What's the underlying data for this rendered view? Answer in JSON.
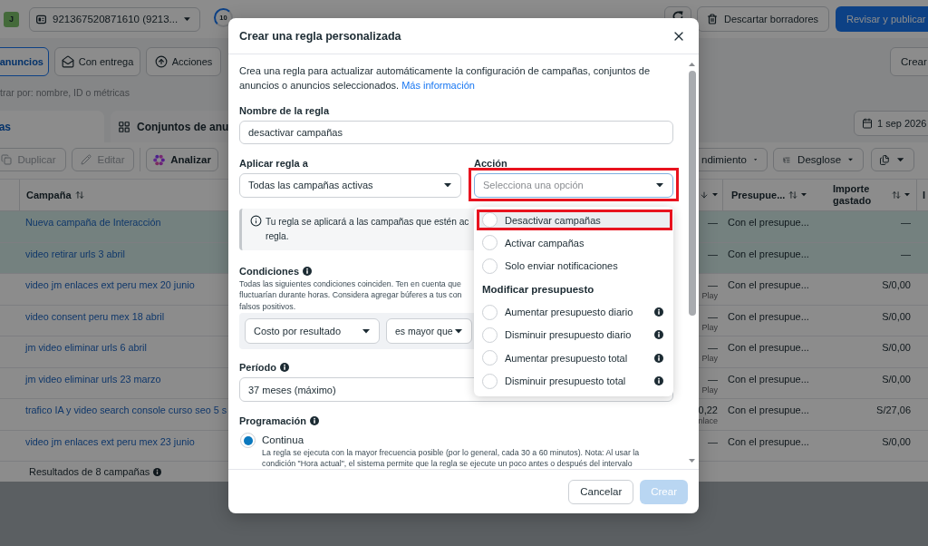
{
  "topbar": {
    "avatar": "J",
    "account": "921367520871610 (9213...",
    "progress": "10",
    "discard_button": "Descartar borradores",
    "publish_button": "Revisar y publicar"
  },
  "filter_bar": {
    "buttons": [
      {
        "label": "anuncios",
        "selected": true
      },
      {
        "label": "Con entrega",
        "selected": false
      },
      {
        "label": "Acciones",
        "selected": false
      }
    ],
    "create_button": "Crear",
    "search": {
      "placeholder": "trar por: nombre, ID o métricas"
    }
  },
  "tabs": [
    {
      "label": "as",
      "selected": true
    },
    {
      "label": "Conjuntos de anu",
      "selected": false
    }
  ],
  "date_range": "1 sep 2026",
  "toolbar": {
    "actions": [
      {
        "label": "Duplicar",
        "disabled": true
      },
      {
        "label": "Editar",
        "disabled": true
      },
      {
        "label": "Analizar",
        "disabled": false
      }
    ],
    "menus": [
      {
        "label": "ndimiento"
      },
      {
        "label": "Desglose"
      }
    ]
  },
  "table": {
    "columns": [
      {
        "label": "Campaña"
      },
      {
        "label": "Presupue..."
      },
      {
        "label": "Importe gastado"
      },
      {
        "label": "I"
      }
    ],
    "rows": [
      {
        "name": "Nueva campaña de Interacción",
        "selected": true,
        "column_2": "—",
        "budget": "Con el presupue...",
        "spent": "—"
      },
      {
        "name": "video retirar urls 3 abril",
        "selected": true,
        "column_2": "—",
        "budget": "Con el presupue...",
        "spent": "—"
      },
      {
        "name": "video jm enlaces ext peru mex 20 junio",
        "selected": false,
        "column_2": "—",
        "column_2_note": "Play",
        "budget": "Con el presupue...",
        "spent": "S/0,00"
      },
      {
        "name": "video consent peru mex 18 abril",
        "selected": false,
        "column_2": "—",
        "column_2_note": "Play",
        "budget": "Con el presupue...",
        "spent": "S/0,00"
      },
      {
        "name": "jm video eliminar urls 6 abril",
        "selected": false,
        "column_2": "—",
        "column_2_note": "Play",
        "budget": "Con el presupue...",
        "spent": "S/0,00"
      },
      {
        "name": "jm video eliminar urls 23 marzo",
        "selected": false,
        "column_2": "—",
        "column_2_note": "Play",
        "budget": "Con el presupue...",
        "spent": "S/0,00"
      },
      {
        "name": "trafico IA y video search console curso seo 5 s",
        "selected": false,
        "column_2": "0,22",
        "column_2_note": "nlace",
        "budget": "Con el presupue...",
        "spent": "S/27,06"
      },
      {
        "name": "video jm enlaces ext peru mex 23 junio",
        "selected": false,
        "column_2": "—",
        "budget": "Con el presupue...",
        "spent": "S/0,00"
      }
    ],
    "footer": "Resultados de 8 campañas"
  },
  "modal": {
    "title": "Crear una regla personalizada",
    "intro": "Crea una regla para actualizar automáticamente la configuración de campañas, conjuntos de anuncios o anuncios seleccionados.",
    "intro_link": "Más información",
    "rule_name": {
      "label": "Nombre de la regla",
      "value": "desactivar campañas"
    },
    "apply_to": {
      "label": "Aplicar regla a",
      "value": "Todas las campañas activas"
    },
    "action": {
      "label": "Acción",
      "placeholder": "Selecciona una opción",
      "focused": true,
      "annotated": true,
      "expanded": true,
      "options": [
        {
          "kind": "option",
          "label": "Desactivar campañas",
          "selected": false,
          "highlighted": true,
          "info": false,
          "annotated": true
        },
        {
          "kind": "option",
          "label": "Activar campañas",
          "selected": false,
          "highlighted": false,
          "info": false,
          "annotated": false
        },
        {
          "kind": "option",
          "label": "Solo enviar notificaciones",
          "selected": false,
          "highlighted": false,
          "info": false,
          "annotated": false
        },
        {
          "kind": "header",
          "label": "Modificar presupuesto"
        },
        {
          "kind": "option",
          "label": "Aumentar presupuesto diario",
          "selected": false,
          "highlighted": false,
          "info": true,
          "annotated": false
        },
        {
          "kind": "option",
          "label": "Disminuir presupuesto diario",
          "selected": false,
          "highlighted": false,
          "info": true,
          "annotated": false
        },
        {
          "kind": "option",
          "label": "Aumentar presupuesto total",
          "selected": false,
          "highlighted": false,
          "info": true,
          "annotated": false
        },
        {
          "kind": "option",
          "label": "Disminuir presupuesto total",
          "selected": false,
          "highlighted": false,
          "info": true,
          "annotated": false
        }
      ]
    },
    "notice": [
      "Tu regla se aplicará a las campañas que estén ac",
      "regla."
    ],
    "conditions": {
      "label": "Condiciones",
      "description": [
        "Todas las siguientes condiciones coinciden. Ten en cuenta que",
        "fluctuarían durante horas. Considera agregar búferes a tus con",
        "falsos positivos."
      ],
      "metric": "Costo por resultado",
      "operator": "es mayor que"
    },
    "period": {
      "label": "Período",
      "value": "37 meses (máximo)"
    },
    "schedule": {
      "label": "Programación",
      "options": [
        {
          "label": "Continua",
          "selected": true,
          "description": [
            "La regla se ejecuta con la mayor frecuencia posible (por lo general, cada 30 a 60 minutos). Nota: Al usar la",
            "condición \"Hora actual\", el sistema permite que la regla se ejecute un poco antes o después del intervalo"
          ]
        }
      ]
    },
    "buttons": [
      {
        "label": "Cancelar",
        "kind": "secondary",
        "disabled": false
      },
      {
        "label": "Crear",
        "kind": "primary",
        "disabled": true
      }
    ]
  }
}
